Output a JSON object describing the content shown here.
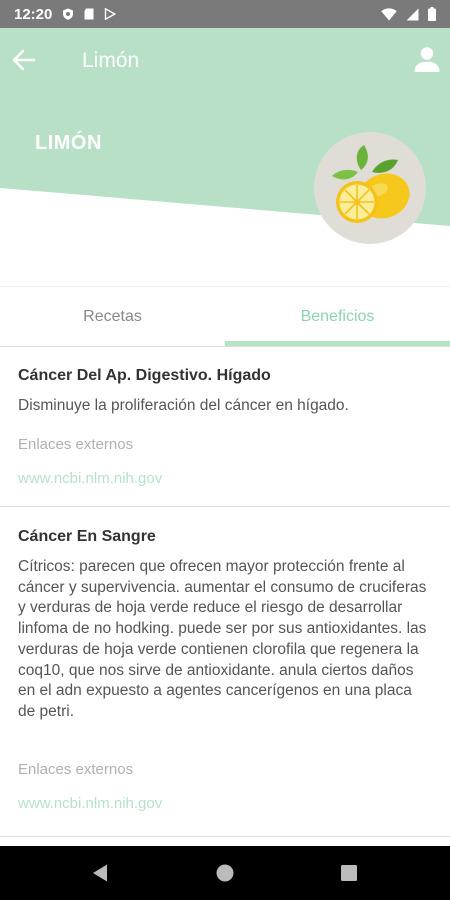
{
  "status_bar": {
    "time": "12:20",
    "icons": [
      "shield-icon",
      "sd-card-icon",
      "play-store-icon"
    ],
    "right_icons": [
      "wifi-icon",
      "cell-signal-icon",
      "battery-icon"
    ]
  },
  "toolbar": {
    "title": "Limón",
    "back_icon": "arrow-left-icon",
    "profile_icon": "user-icon"
  },
  "header": {
    "fruit_name": "LIMÓN",
    "accent_color": "#b8e0c7"
  },
  "tabs": [
    {
      "label": "Recetas",
      "selected": false
    },
    {
      "label": "Beneficios",
      "selected": true
    }
  ],
  "benefits": [
    {
      "title": "Cáncer Del Ap. Digestivo. Hígado",
      "description": "Disminuye la proliferación del cáncer en hígado.",
      "links_label": "Enlaces externos",
      "link": "www.ncbi.nlm.nih.gov"
    },
    {
      "title": "Cáncer En Sangre",
      "description": "Cítricos: parecen que ofrecen mayor protección frente al cáncer y supervivencia. aumentar el consumo de cruciferas y verduras de hoja verde reduce el riesgo de desarrollar linfoma de no hodking. puede ser por sus antioxidantes. las verduras de hoja verde contienen clorofila que regenera la coq10, que nos sirve de antioxidante. anula ciertos daños en el adn expuesto a agentes cancerígenos en una placa de petri.",
      "links_label": "Enlaces externos",
      "link": "www.ncbi.nlm.nih.gov"
    }
  ],
  "nav_bar": {
    "icons": [
      "back-triangle-icon",
      "home-circle-icon",
      "recents-square-icon"
    ]
  }
}
